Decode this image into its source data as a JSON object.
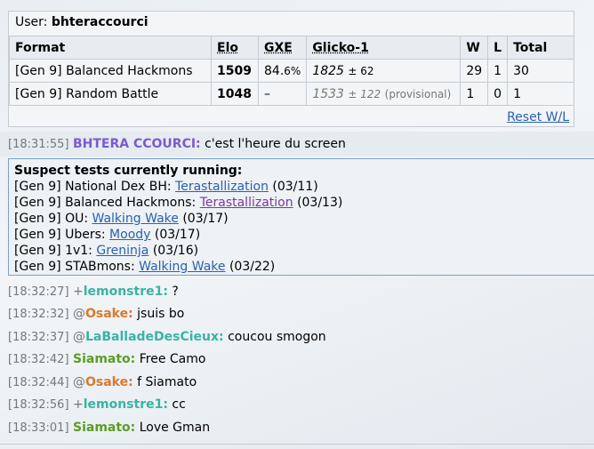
{
  "rankings": {
    "user_label": "User:",
    "username": "bhteraccourci",
    "headers": [
      "Format",
      "Elo",
      "GXE",
      "Glicko-1",
      "W",
      "L",
      "Total"
    ],
    "rows": [
      {
        "format": "[Gen 9] Balanced Hackmons",
        "elo": "1509",
        "gxe": "84.",
        "gxe_small": "6%",
        "glicko": "1825",
        "glicko_dev": "± 62",
        "provisional": "",
        "w": "29",
        "l": "1",
        "total": "30"
      },
      {
        "format": "[Gen 9] Random Battle",
        "elo": "1048",
        "gxe": "–",
        "gxe_small": "",
        "glicko": "1533",
        "glicko_dev": "± 122",
        "provisional": "(provisional)",
        "w": "1",
        "l": "0",
        "total": "1"
      }
    ],
    "reset_label": "Reset W/L"
  },
  "messages": [
    {
      "time": "[18:31:55]",
      "rank": "",
      "name": "BHTERA CCOURCI:",
      "text": "c'est l'heure du screen",
      "color": "#7a5ad0"
    },
    {
      "time": "[18:32:27]",
      "rank": "+",
      "name": "lemonstre1:",
      "text": "?",
      "color": "#3ab3a4"
    },
    {
      "time": "[18:32:32]",
      "rank": "@",
      "name": "Osake:",
      "text": "jsuis bo",
      "color": "#d87a2e"
    },
    {
      "time": "[18:32:37]",
      "rank": "@",
      "name": "LaBalladeDesCieux:",
      "text": "coucou smogon",
      "color": "#3ab3a4"
    },
    {
      "time": "[18:32:42]",
      "rank": "",
      "name": "Siamato:",
      "text": "Free Camo",
      "color": "#5a9e23"
    },
    {
      "time": "[18:32:44]",
      "rank": "@",
      "name": "Osake:",
      "text": "f Siamato",
      "color": "#d87a2e"
    },
    {
      "time": "[18:32:56]",
      "rank": "+",
      "name": "lemonstre1:",
      "text": "cc",
      "color": "#3ab3a4"
    },
    {
      "time": "[18:33:01]",
      "rank": "",
      "name": "Siamato:",
      "text": "Love Gman",
      "color": "#5a9e23"
    }
  ],
  "suspect": {
    "heading": "Suspect tests currently running:",
    "items": [
      {
        "format": "[Gen 9] National Dex BH:",
        "link": "Terastallization",
        "date": "(03/11)",
        "visited": false
      },
      {
        "format": "[Gen 9] Balanced Hackmons:",
        "link": "Terastallization",
        "date": "(03/13)",
        "visited": true
      },
      {
        "format": "[Gen 9] OU:",
        "link": "Walking Wake",
        "date": "(03/17)",
        "visited": false
      },
      {
        "format": "[Gen 9] Ubers:",
        "link": "Moody",
        "date": "(03/17)",
        "visited": false
      },
      {
        "format": "[Gen 9] 1v1:",
        "link": "Greninja",
        "date": "(03/16)",
        "visited": false
      },
      {
        "format": "[Gen 9] STABmons:",
        "link": "Walking Wake",
        "date": "(03/22)",
        "visited": false
      }
    ]
  }
}
